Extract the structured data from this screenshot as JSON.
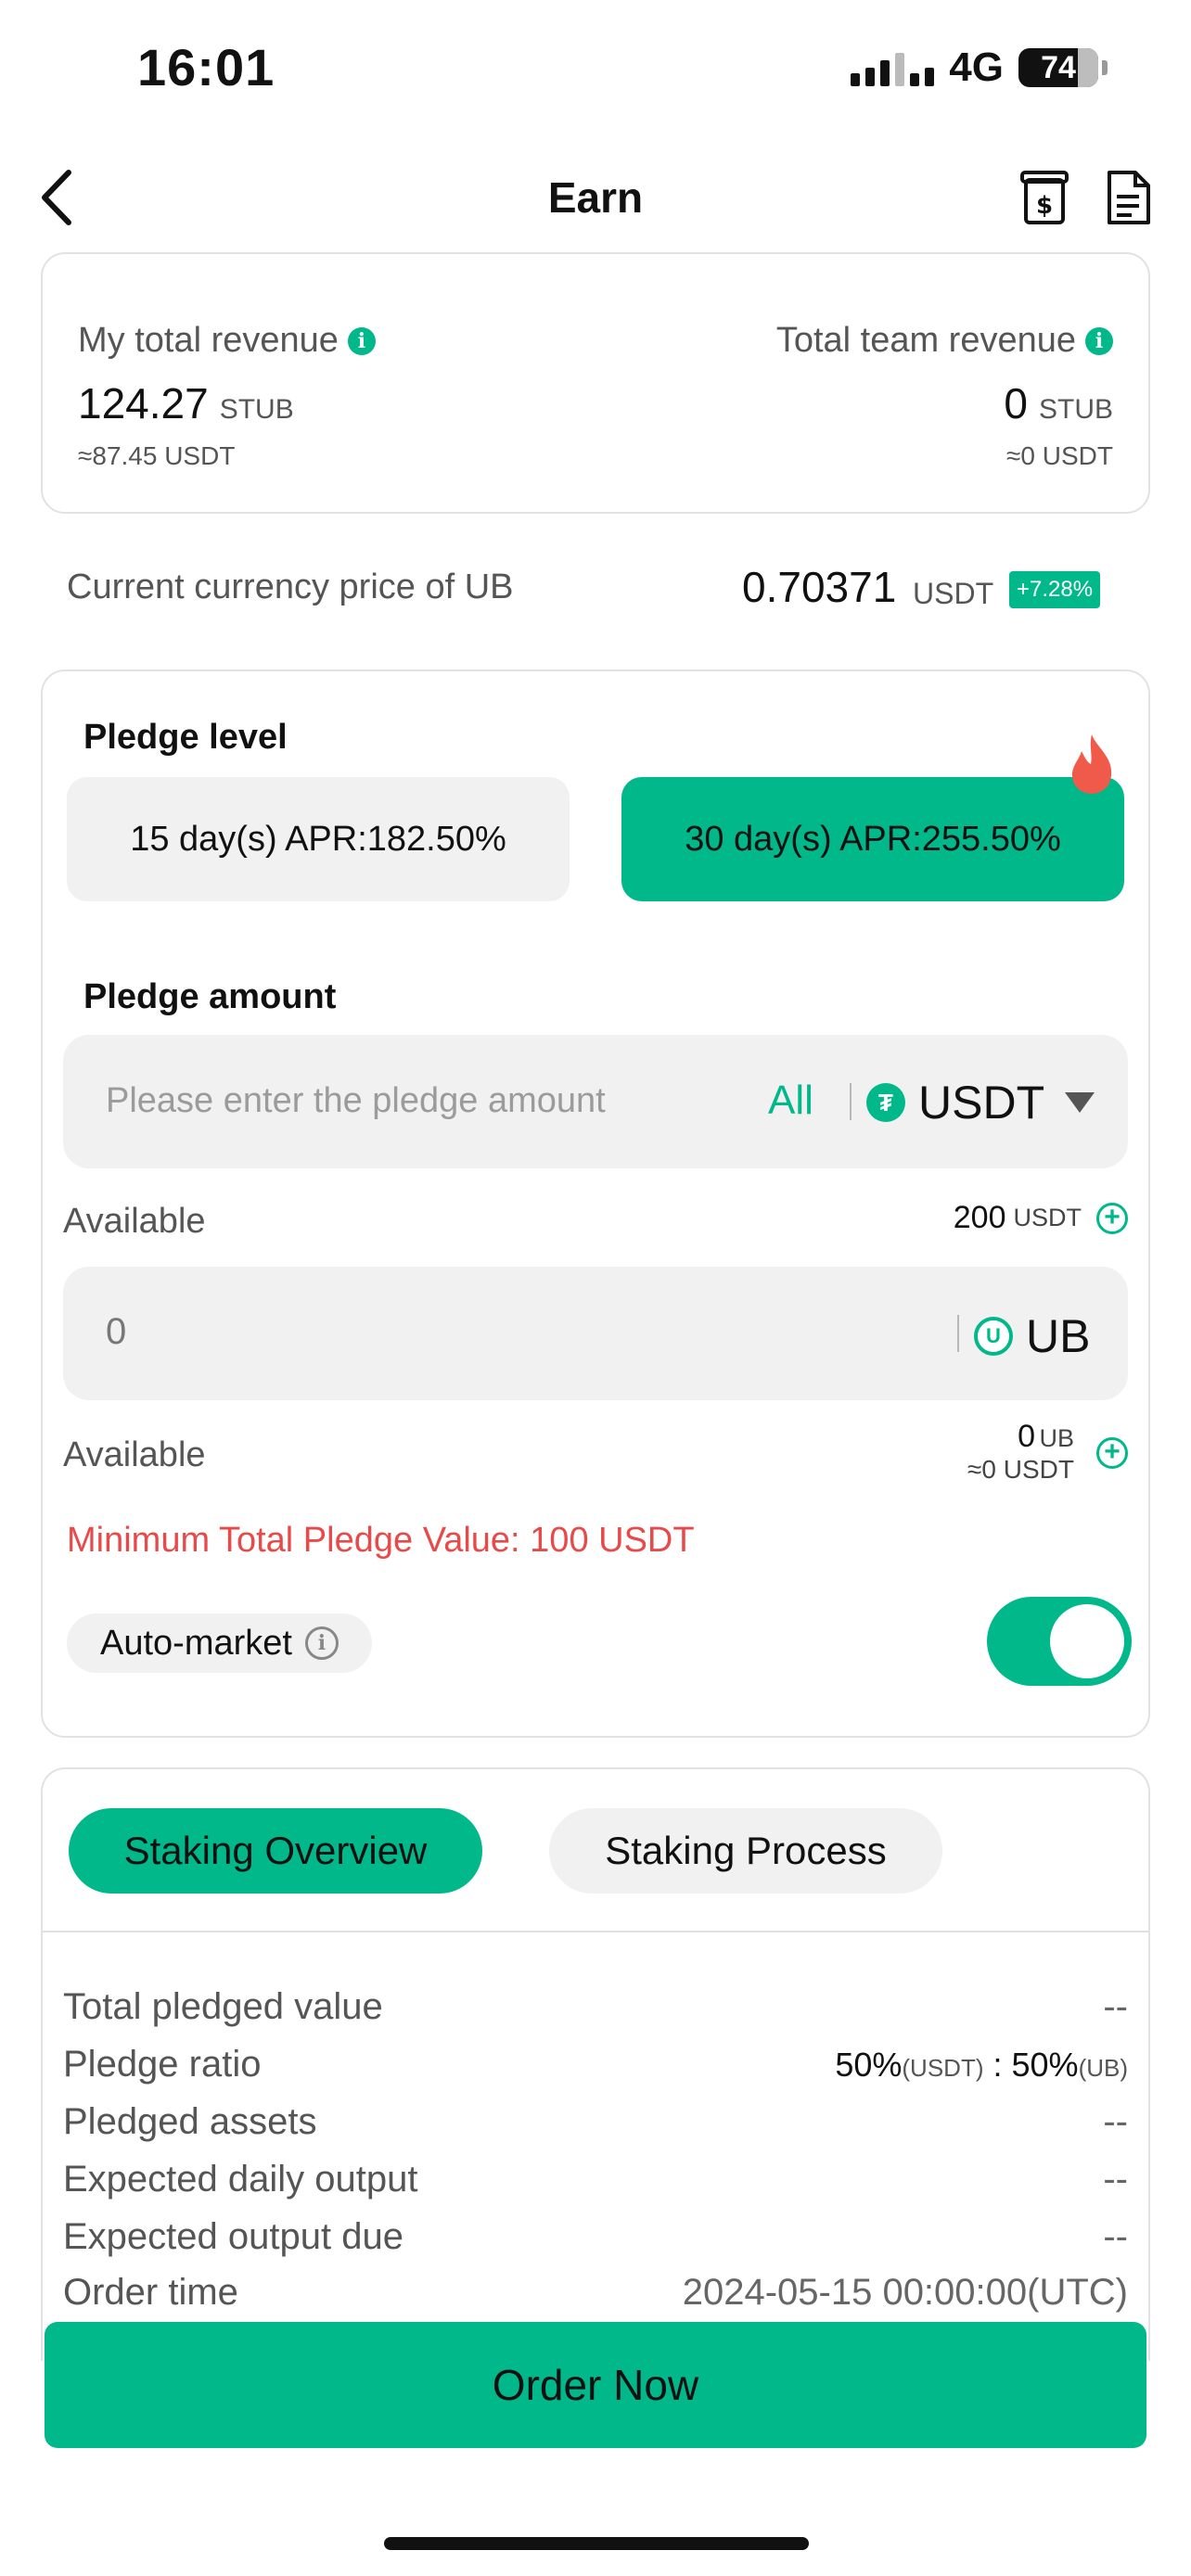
{
  "status_bar": {
    "time": "16:01",
    "network": "4G",
    "battery": "74"
  },
  "nav": {
    "title": "Earn",
    "back_icon": "chevron-left-icon",
    "icons": [
      "dollar-note-icon",
      "document-icon"
    ]
  },
  "revenue": {
    "my_total_label": "My total revenue",
    "my_total_amount": "124.27",
    "my_total_unit": "STUB",
    "my_total_approx": "≈87.45 USDT",
    "team_total_label": "Total team revenue",
    "team_total_amount": "0",
    "team_total_unit": "STUB",
    "team_total_approx": "≈0 USDT"
  },
  "price": {
    "label": "Current currency price of UB",
    "value": "0.70371",
    "unit": "USDT",
    "change": "+7.28%"
  },
  "pledge": {
    "level_title": "Pledge level",
    "levels": [
      "15 day(s) APR:182.50%",
      "30 day(s) APR:255.50%"
    ],
    "selected_level": 1,
    "amount_title": "Pledge amount",
    "amount_placeholder": "Please enter the pledge amount",
    "all_label": "All",
    "currency": "USDT",
    "available_label": "Available",
    "usdt_available": "200",
    "usdt_unit": "USDT",
    "ub_value": "0",
    "ub_currency": "UB",
    "ub_available": "0",
    "ub_unit": "UB",
    "ub_available_approx": "≈0 USDT",
    "min_warning": "Minimum Total Pledge Value: 100 USDT",
    "auto_market_label": "Auto-market",
    "auto_market_on": true
  },
  "overview": {
    "tabs": [
      "Staking Overview",
      "Staking Process"
    ],
    "active_tab": 0,
    "rows": [
      {
        "label": "Total pledged value",
        "value": "--"
      },
      {
        "label": "Pledge ratio",
        "value": ""
      },
      {
        "label": "Pledged assets",
        "value": "--"
      },
      {
        "label": "Expected daily output",
        "value": "--"
      },
      {
        "label": "Expected output due",
        "value": "--"
      },
      {
        "label": "Order time",
        "value": "2024-05-15 00:00:00(UTC)"
      }
    ],
    "ratio": {
      "left_pct": "50%",
      "left_unit": "(USDT)",
      "sep": " : ",
      "right_pct": "50%",
      "right_unit": "(UB)"
    }
  },
  "order_button": "Order Now",
  "colors": {
    "accent": "#00b88a",
    "warning": "#e84a4a",
    "fire": "#f05a4a"
  }
}
